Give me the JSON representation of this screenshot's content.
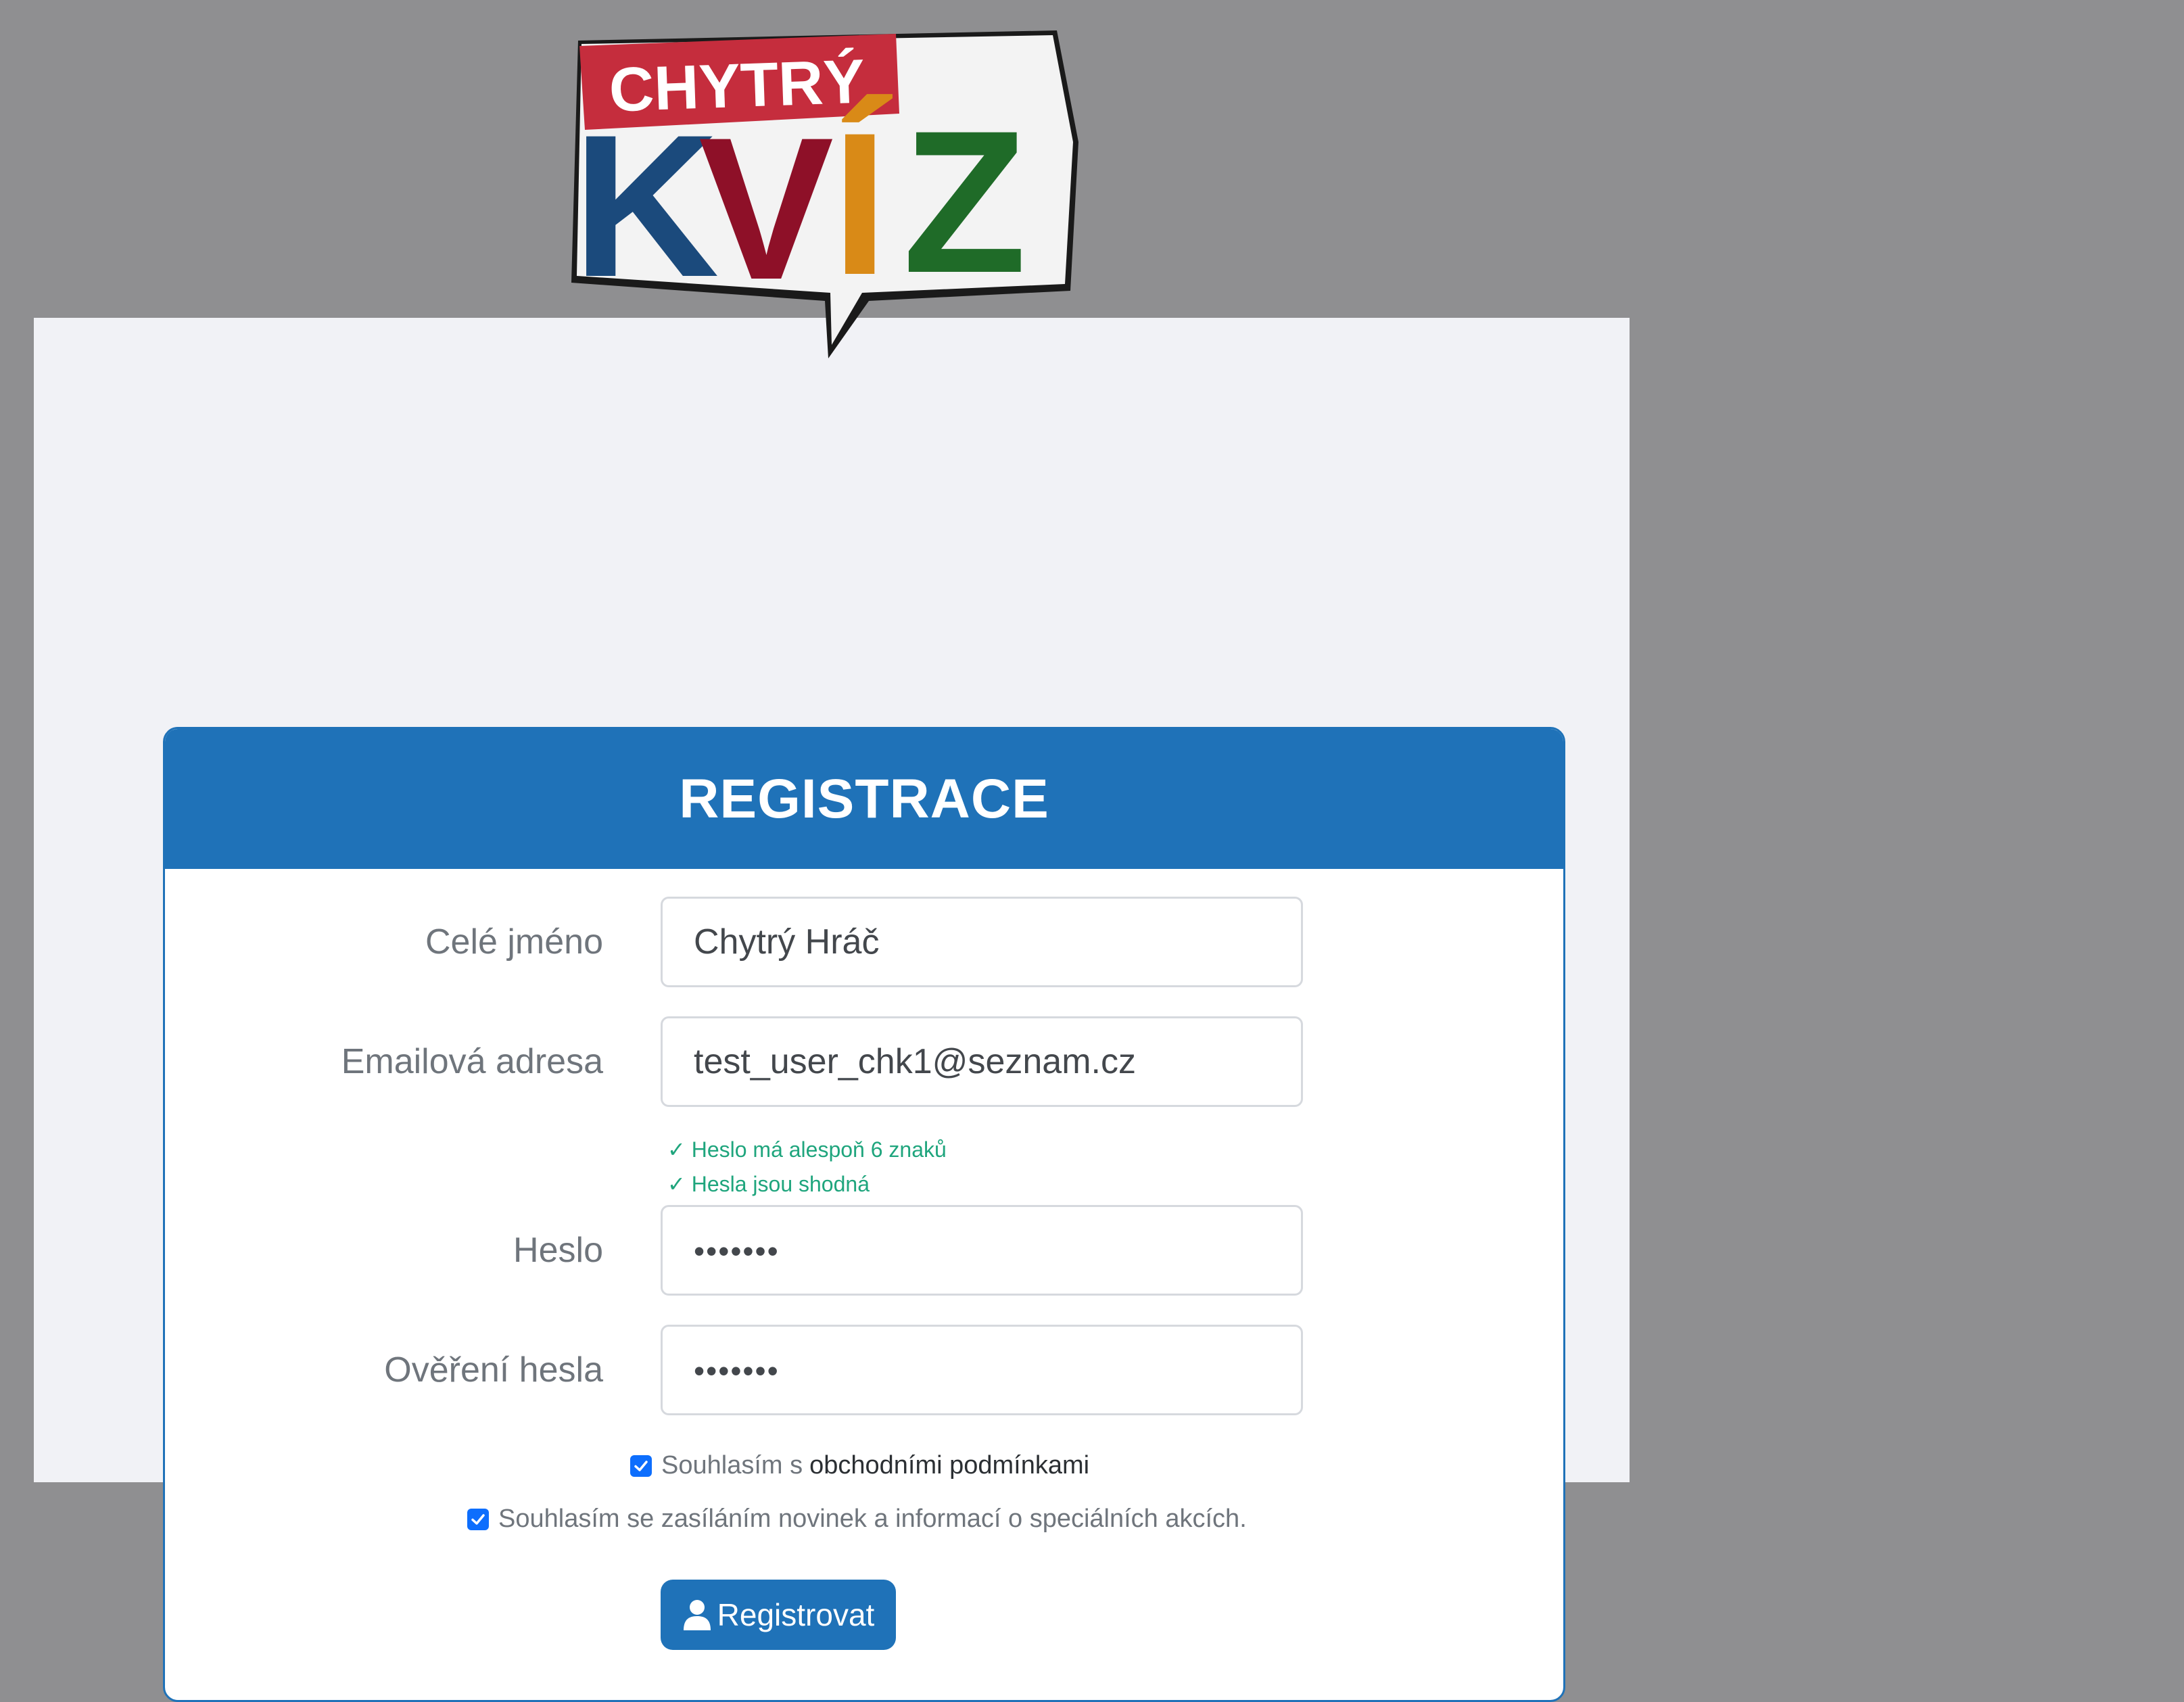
{
  "logo": {
    "line1": "CHYTRÝ",
    "line2": "KVÍZ",
    "colors": {
      "banner": "#c52d3d",
      "k": "#1b4a7c",
      "v": "#8e1028",
      "i": "#d98a17",
      "z": "#1f6b28"
    }
  },
  "form": {
    "title": "REGISTRACE",
    "fields": {
      "name": {
        "label": "Celé jméno",
        "value": "Chytrý Hráč"
      },
      "email": {
        "label": "Emailová adresa",
        "value": "test_user_chk1@seznam.cz"
      },
      "password": {
        "label": "Heslo",
        "value": "•••••••"
      },
      "password_confirm": {
        "label": "Ověření hesla",
        "value": "•••••••"
      }
    },
    "hints": {
      "length": "✓ Heslo má alespoň 6 znaků",
      "match": "✓ Hesla jsou shodná"
    },
    "terms": {
      "prefix": "Souhlasím s",
      "link": "obchodními podmínkami",
      "checked": true
    },
    "newsletter": {
      "text": "Souhlasím se zasíláním novinek a informací o speciálních akcích.",
      "checked": true
    },
    "submit_label": "Registrovat"
  },
  "colors": {
    "primary": "#1f72b8",
    "success": "#1fa57d",
    "checkbox": "#0d6efd",
    "backdrop": "#8f8f91",
    "panel": "#f1f2f6"
  }
}
